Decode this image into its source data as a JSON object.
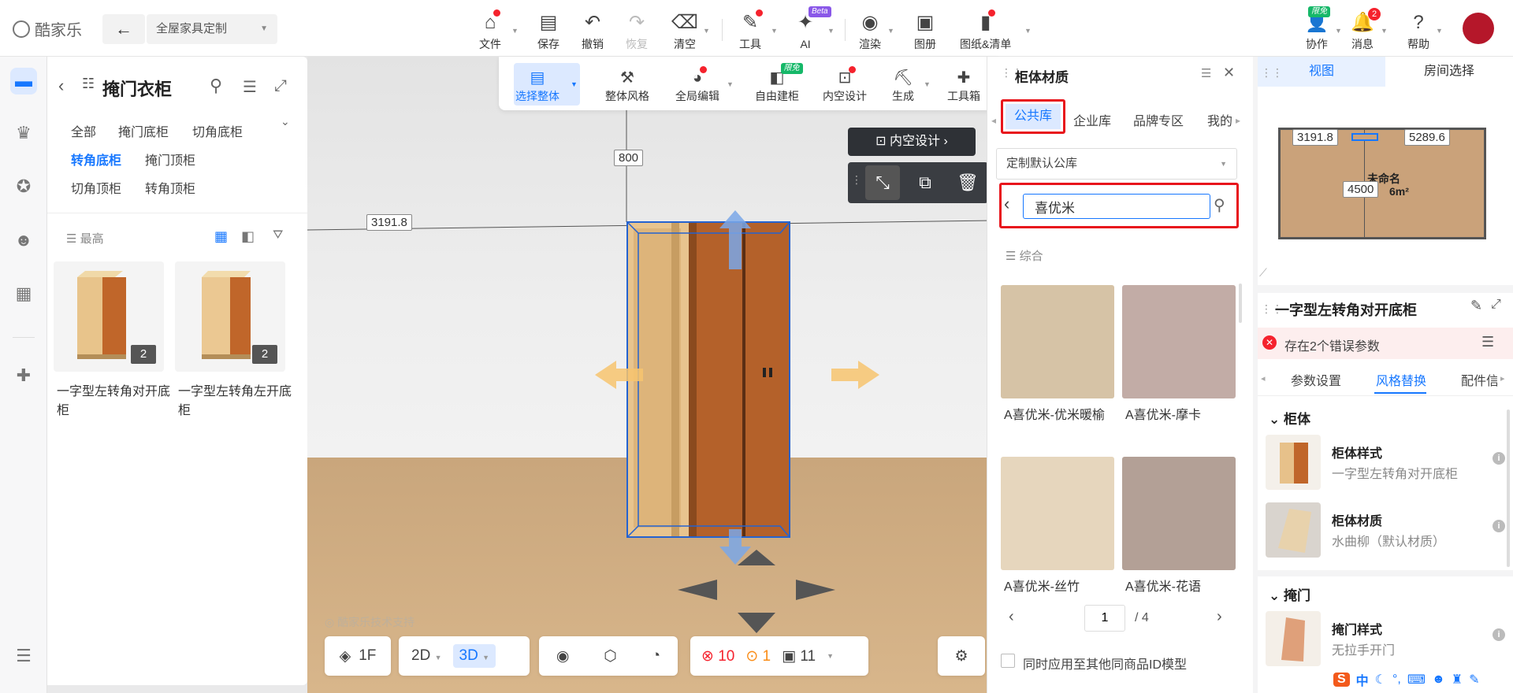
{
  "app": {
    "logo_text": "酷家乐",
    "mode_select": "全屋家具定制"
  },
  "toolbar": {
    "file": "文件",
    "save": "保存",
    "undo": "撤销",
    "redo": "恢复",
    "clear": "清空",
    "tools": "工具",
    "ai": "AI",
    "ai_badge": "Beta",
    "render": "渲染",
    "image": "图册",
    "drawings": "图纸&清单"
  },
  "topright": {
    "collab": "协作",
    "collab_badge": "限免",
    "messages": "消息",
    "messages_count": "2",
    "help": "帮助"
  },
  "category": {
    "title": "掩门衣柜",
    "links": [
      "全部",
      "掩门底柜",
      "切角底柜",
      "转角底柜",
      "掩门顶柜",
      "切角顶柜",
      "转角顶柜"
    ],
    "active_link": "转角底柜",
    "sort_label": "最高",
    "products": [
      {
        "name": "一字型左转角对开底柜",
        "count": "2"
      },
      {
        "name": "一字型左转角左开底柜",
        "count": "2"
      }
    ]
  },
  "subtoolbar": {
    "select_all": "选择整体",
    "overall_style": "整体风格",
    "global_edit": "全局编辑",
    "free_cabinet": "自由建柜",
    "free_badge": "限免",
    "interior_design": "内空设计",
    "generate": "生成",
    "toolbox": "工具箱"
  },
  "scene": {
    "dim_top": "800",
    "dim_left": "3191.8",
    "inner_design_btn": "内空设计",
    "watermark": "酷家乐技术支持",
    "floor": "1F",
    "view_2d": "2D",
    "view_3d": "3D",
    "errors": "10",
    "warnings": "1",
    "other_count": "11"
  },
  "material_panel": {
    "title": "柜体材质",
    "tabs": [
      "公共库",
      "企业库",
      "品牌专区",
      "我的"
    ],
    "library_select": "定制默认公库",
    "search_value": "喜优米",
    "sort_label": "综合",
    "materials": [
      {
        "name": "A喜优米-优米暖榆",
        "color": "#d6c3a6"
      },
      {
        "name": "A喜优米-摩卡",
        "color": "#c2aca6"
      },
      {
        "name": "A喜优米-丝竹",
        "color": "#e6d6bd"
      },
      {
        "name": "A喜优米-花语",
        "color": "#b3a096"
      }
    ],
    "page_current": "1",
    "page_total": "/ 4",
    "apply_checkbox_label": "同时应用至其他同商品ID模型"
  },
  "right_panel": {
    "tabs": [
      "视图",
      "房间选择"
    ],
    "minimap": {
      "dim_left": "3191.8",
      "dim_right": "5289.6",
      "dim_center": "4500",
      "room_name": "未命名",
      "room_area": "6m²"
    },
    "title": "一字型左转角对开底柜",
    "error_notice": "存在2个错误参数",
    "prop_tabs": [
      "参数设置",
      "风格替换",
      "配件信"
    ],
    "section_cabinet": "柜体",
    "section_door": "掩门",
    "items": [
      {
        "title": "柜体样式",
        "subtitle": "一字型左转角对开底柜"
      },
      {
        "title": "柜体材质",
        "subtitle": "水曲柳（默认材质）"
      },
      {
        "title": "掩门样式",
        "subtitle": "无拉手开门"
      }
    ]
  },
  "ime": {
    "label": "中"
  }
}
